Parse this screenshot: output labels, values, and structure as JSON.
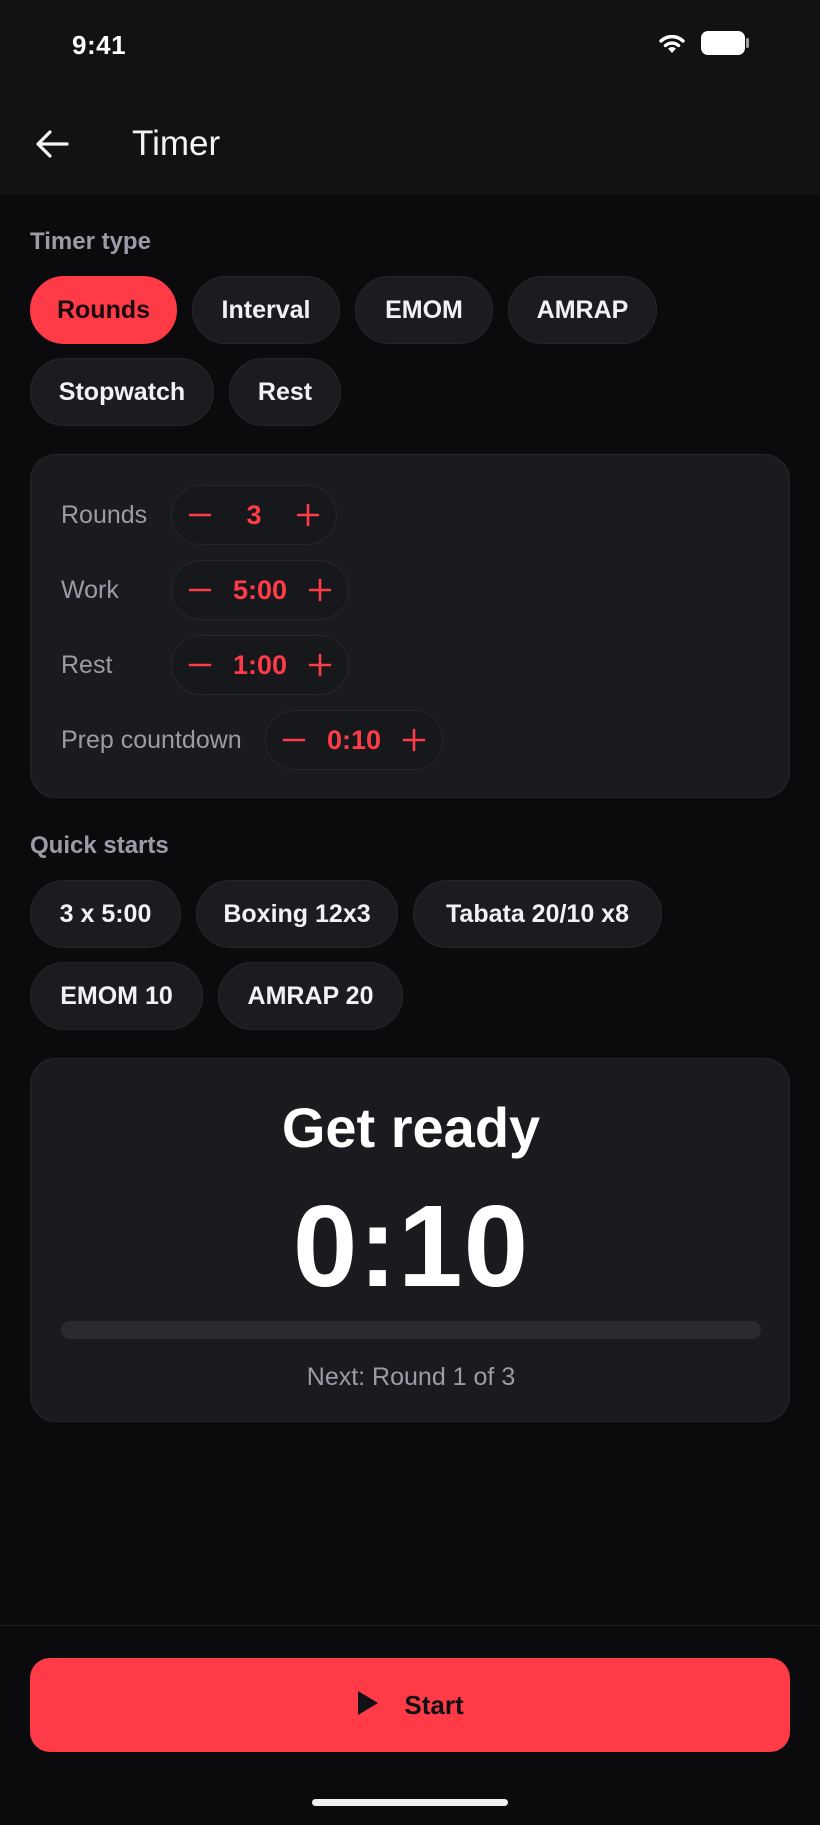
{
  "status_bar": {
    "time": "9:41",
    "wifi_icon": "wifi-icon",
    "battery_icon": "battery-icon"
  },
  "app_bar": {
    "title": "Timer",
    "back_icon": "arrow-left-icon"
  },
  "timer_type": {
    "label": "Timer type",
    "options": [
      "Rounds",
      "Interval",
      "EMOM",
      "AMRAP",
      "Stopwatch",
      "Rest"
    ],
    "selected": "Rounds"
  },
  "settings": {
    "rounds": {
      "label": "Rounds",
      "value": "3"
    },
    "work": {
      "label": "Work",
      "value": "5:00"
    },
    "rest": {
      "label": "Rest",
      "value": "1:00"
    },
    "prep": {
      "label": "Prep countdown",
      "value": "0:10"
    }
  },
  "quick_starts": {
    "label": "Quick starts",
    "items": [
      "3 x 5:00",
      "Boxing 12x3",
      "Tabata 20/10 x8",
      "EMOM 10",
      "AMRAP 20"
    ]
  },
  "display": {
    "phase": "Get ready",
    "clock": "0:10",
    "progress_fraction": 0,
    "next": "Next: Round 1 of 3"
  },
  "actions": {
    "start_label": "Start",
    "start_icon": "play-icon"
  },
  "colors": {
    "accent": "#ff3b47",
    "background": "#0b0b0e",
    "surface": "#1a1b1e",
    "muted_text": "#9c9ca6"
  }
}
